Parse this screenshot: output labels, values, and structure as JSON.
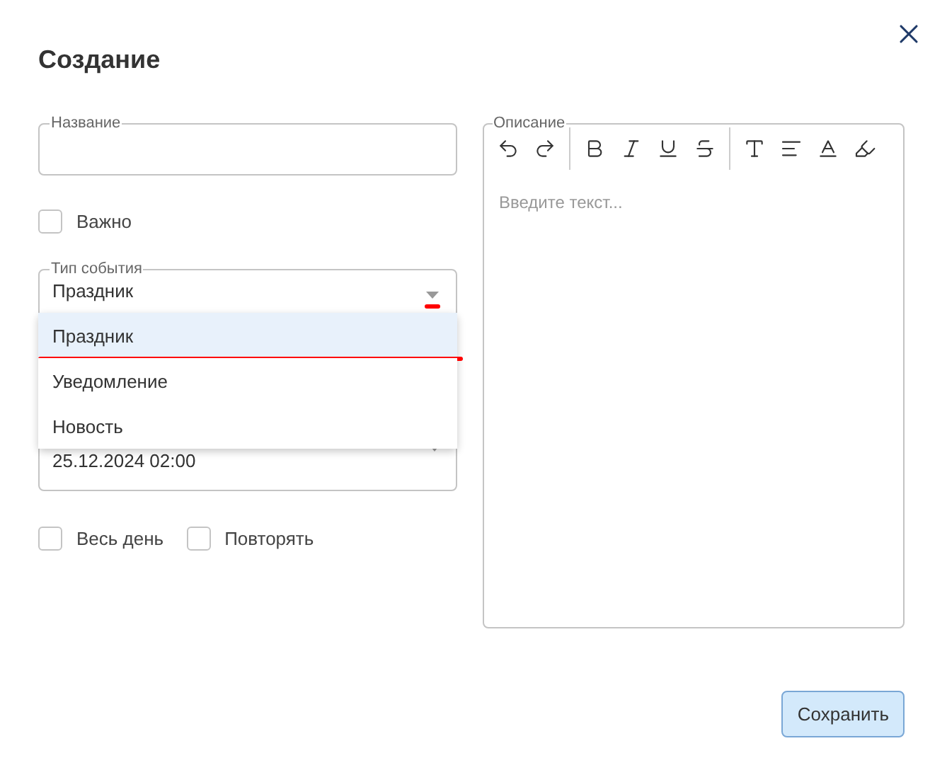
{
  "dialog": {
    "title": "Создание"
  },
  "name_field": {
    "label": "Название"
  },
  "important": {
    "label": "Важно",
    "checked": false
  },
  "event_type": {
    "label": "Тип события",
    "value": "Праздник",
    "expanded": true,
    "options": [
      {
        "label": "Праздник",
        "selected": true
      },
      {
        "label": "Уведомление",
        "selected": false
      },
      {
        "label": "Новость",
        "selected": false
      }
    ]
  },
  "date_field": {
    "value": "25.12.2024 02:00"
  },
  "options": [
    {
      "label": "Весь день",
      "checked": false
    },
    {
      "label": "Повторять",
      "checked": false
    }
  ],
  "description": {
    "label": "Описание",
    "placeholder": "Введите текст..."
  },
  "buttons": [
    {
      "label": "Сохранить"
    }
  ]
}
